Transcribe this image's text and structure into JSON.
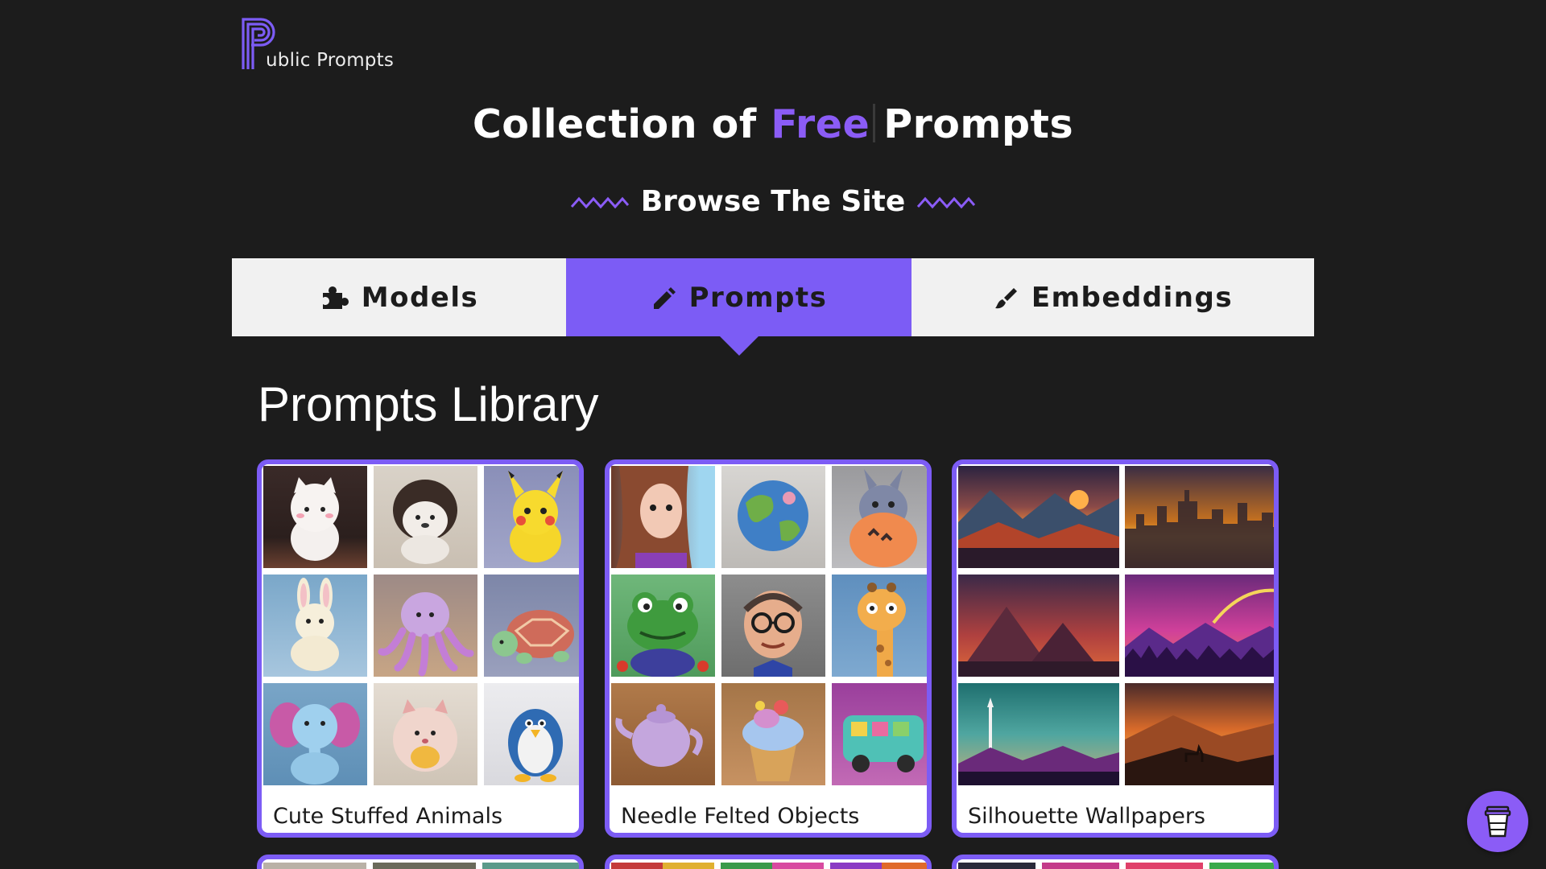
{
  "header": {
    "logo_letter_icon": "p-monogram-icon",
    "logo_text": "ublic Prompts"
  },
  "hero": {
    "title_prefix": "Collection of",
    "title_accent": "Free",
    "title_suffix": "Prompts",
    "browse_label": "Browse The Site"
  },
  "tabs": [
    {
      "label": "Models",
      "icon": "puzzle-icon",
      "active": false
    },
    {
      "label": "Prompts",
      "icon": "pencil-icon",
      "active": true
    },
    {
      "label": "Embeddings",
      "icon": "brush-icon",
      "active": false
    }
  ],
  "section": {
    "title": "Prompts Library"
  },
  "cards": [
    {
      "title": "Cute Stuffed Animals",
      "thumbnails": [
        "white-cat-plush",
        "hedgehog-plush",
        "pikachu-plush",
        "bunny-plush",
        "octopus-plush",
        "turtle-plush",
        "elephant-plush",
        "hamster-plush",
        "penguin-plush"
      ]
    },
    {
      "title": "Needle Felted Objects",
      "thumbnails": [
        "felted-girl",
        "felted-earth",
        "felted-totoro",
        "felted-frog",
        "felted-man-glasses",
        "felted-giraffe",
        "felted-teapot",
        "felted-cupcake",
        "felted-bus"
      ]
    },
    {
      "title": "Silhouette Wallpapers",
      "thumbnails": [
        "mountain-sunset",
        "city-skyline-sunset",
        "pyramids-dusk",
        "purple-forest-rainbow",
        "rocket-launch-teal",
        "deer-orange-hills"
      ]
    }
  ],
  "colors": {
    "background": "#1c1c1c",
    "accent": "#7c5cf5",
    "accent_text": "#8b5cf6",
    "tab_inactive": "#f1f1f1",
    "card_bg": "#ffffff"
  },
  "floating_button": {
    "icon": "coffee-cup-icon"
  }
}
